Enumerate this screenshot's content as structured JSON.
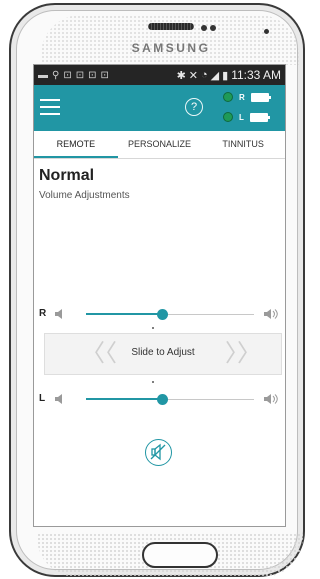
{
  "device": {
    "brand": "SAMSUNG"
  },
  "status_bar": {
    "time": "11:33 AM",
    "battery_level": "full"
  },
  "app_bar": {
    "menu_icon": "hamburger-menu-icon",
    "help_icon_glyph": "?",
    "right_label": "R",
    "left_label": "L",
    "accent_color": "#2196a4"
  },
  "tabs": [
    {
      "label": "REMOTE",
      "active": true
    },
    {
      "label": "PERSONALIZE",
      "active": false
    },
    {
      "label": "TINNITUS",
      "active": false
    }
  ],
  "main": {
    "program_name": "Normal",
    "section_label": "Volume Adjustments"
  },
  "sliders": {
    "right": {
      "label": "R",
      "value": 0.45
    },
    "left": {
      "label": "L",
      "value": 0.45
    }
  },
  "adjust": {
    "label": "Slide to Adjust"
  }
}
